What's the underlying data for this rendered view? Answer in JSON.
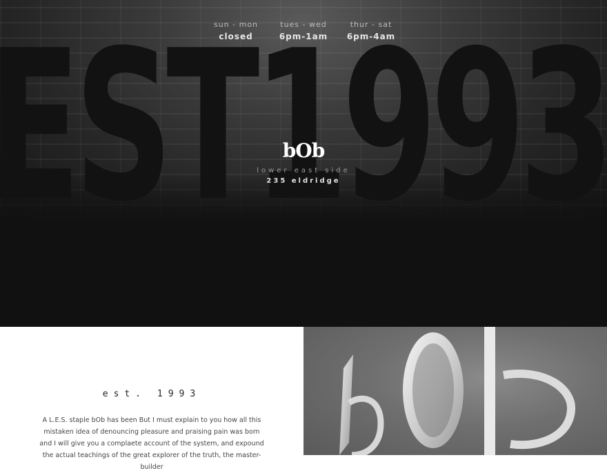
{
  "hero": {
    "background_text": "EST1993",
    "hours": [
      {
        "days": "sun - mon",
        "time": "closed"
      },
      {
        "days": "tues - wed",
        "time": "6pm-1am"
      },
      {
        "days": "thur - sat",
        "time": "6pm-4am"
      }
    ],
    "logo": "bOb",
    "location": "lower east side",
    "address": "235 eldridge"
  },
  "about": {
    "heading": "est. 1993",
    "body": "A L.E.S. staple bOb has been But I must explain to you how all this mistaken idea of denouncing pleasure and praising pain was born and I will give you a complaete account of the system, and expound the actual teachings of the great explorer of the truth, the master-builder"
  },
  "photo": {
    "sign_text": "bOb"
  }
}
